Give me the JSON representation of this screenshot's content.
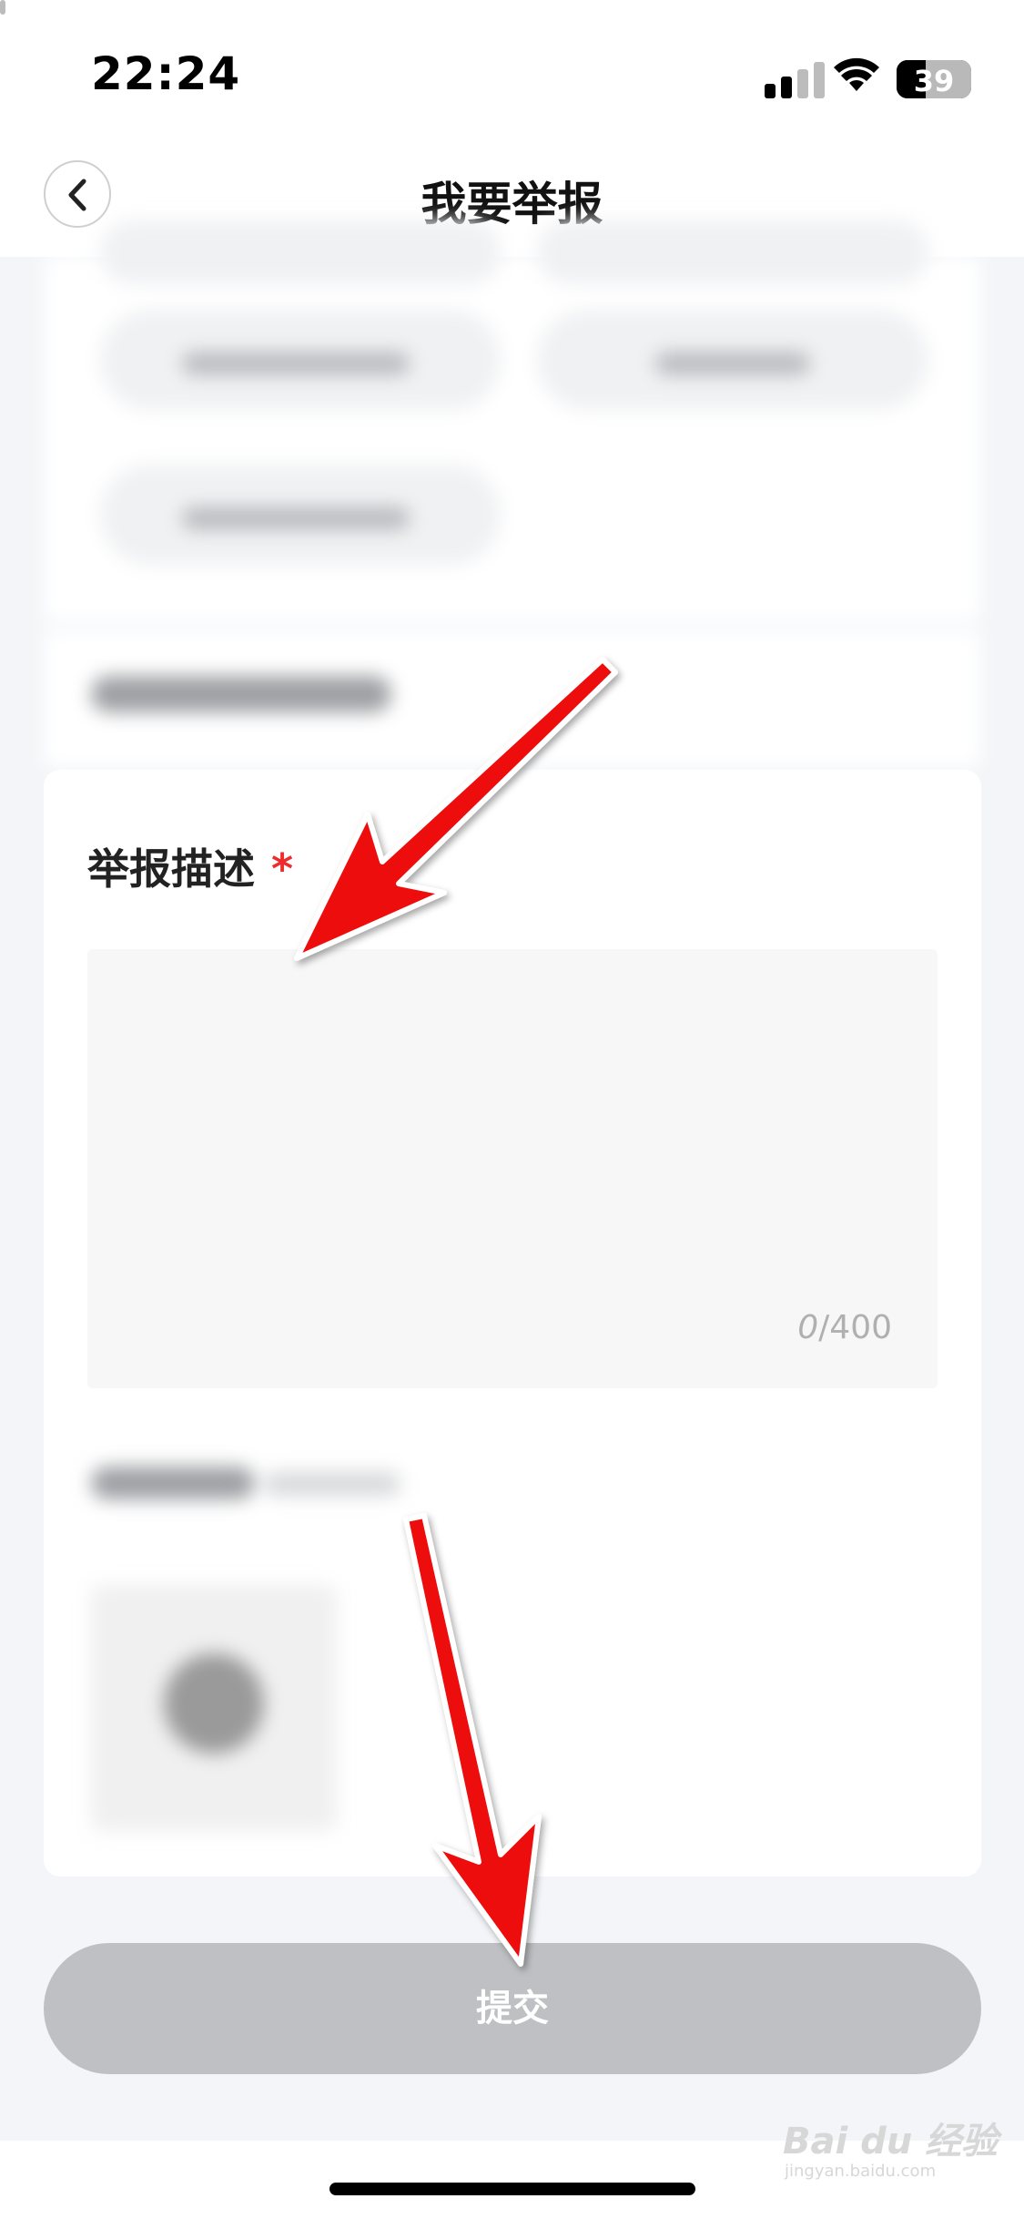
{
  "status_bar": {
    "time": "22:24",
    "battery": "39"
  },
  "nav": {
    "title": "我要举报"
  },
  "form": {
    "description_label": "举报描述",
    "required_mark": "*",
    "counter_current": "0",
    "counter_sep_max": "/400"
  },
  "submit_label": "提交",
  "watermark": {
    "brand": "Bai du 经验",
    "url": "jingyan.baidu.com"
  },
  "colors": {
    "accent_arrow": "#ee0d0d",
    "required": "#f02b2b",
    "submit_disabled": "#bfc0c3"
  }
}
